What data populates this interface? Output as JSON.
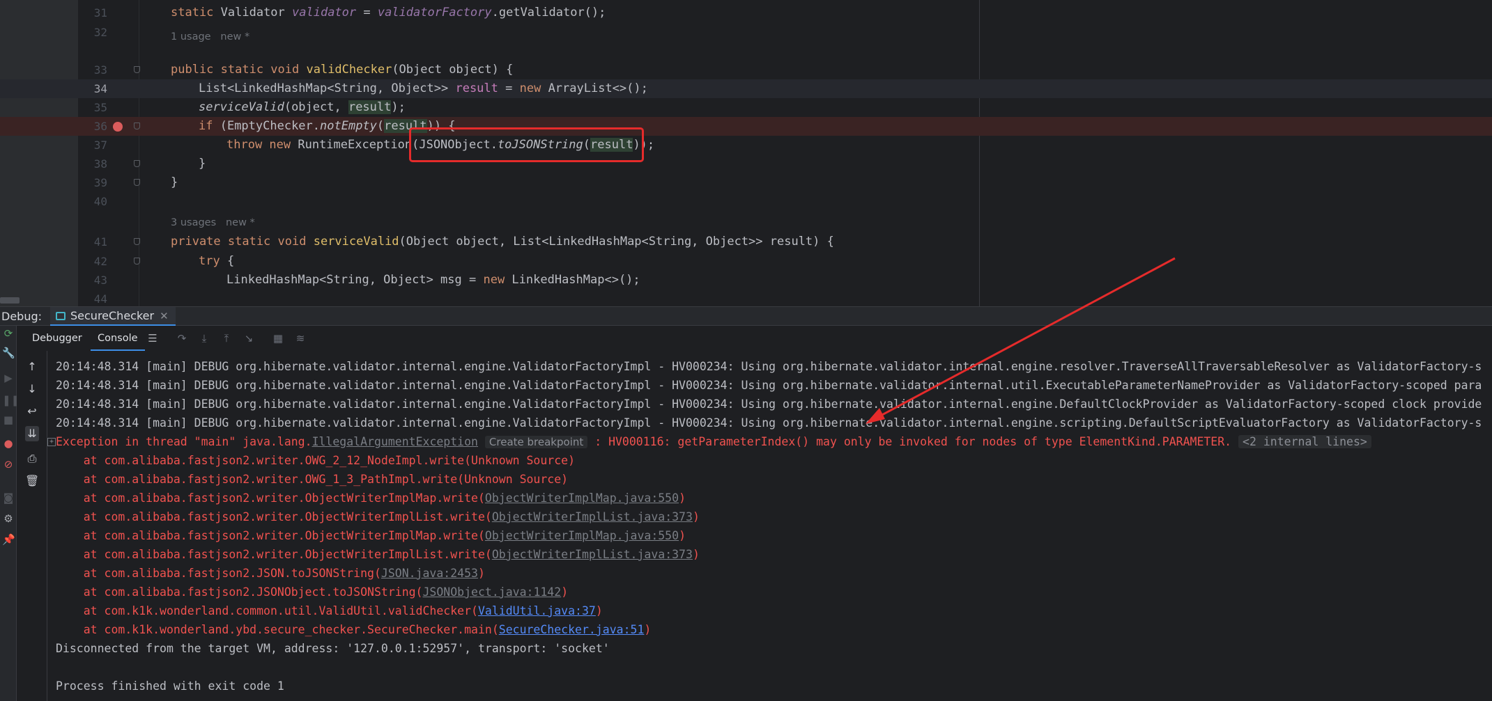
{
  "editor": {
    "lines": [
      {
        "num": "31",
        "code": "static Validator validator = validatorFactory.getValidator();"
      },
      {
        "num": "32",
        "code": ""
      },
      {
        "num": "33",
        "code": "public static void validChecker(Object object) {"
      },
      {
        "num": "34",
        "code": "List<LinkedHashMap<String, Object>> result = new ArrayList<>();"
      },
      {
        "num": "35",
        "code": "serviceValid(object, result);"
      },
      {
        "num": "36",
        "code": "if (EmptyChecker.notEmpty(result)) {"
      },
      {
        "num": "37",
        "code": "throw new RuntimeException(JSONObject.toJSONString(result));"
      },
      {
        "num": "38",
        "code": "}"
      },
      {
        "num": "39",
        "code": "}"
      },
      {
        "num": "40",
        "code": ""
      },
      {
        "num": "41",
        "code": "private static void serviceValid(Object object, List<LinkedHashMap<String, Object>> result) {"
      },
      {
        "num": "42",
        "code": "try {"
      },
      {
        "num": "43",
        "code": "LinkedHashMap<String, Object> msg = new LinkedHashMap<>();"
      },
      {
        "num": "44",
        "code": ""
      }
    ],
    "hint_valid_checker": "1 usage   new *",
    "hint_service_valid": "3 usages   new *"
  },
  "debug": {
    "title": "Debug:",
    "session_tab": "SecureChecker",
    "close_glyph": "✕",
    "subtabs": {
      "debugger": "Debugger",
      "console": "Console"
    }
  },
  "console": {
    "log_lines": [
      "20:14:48.314 [main] DEBUG org.hibernate.validator.internal.engine.ValidatorFactoryImpl - HV000234: Using org.hibernate.validator.internal.engine.resolver.TraverseAllTraversableResolver as ValidatorFactory-s",
      "20:14:48.314 [main] DEBUG org.hibernate.validator.internal.engine.ValidatorFactoryImpl - HV000234: Using org.hibernate.validator.internal.util.ExecutableParameterNameProvider as ValidatorFactory-scoped para",
      "20:14:48.314 [main] DEBUG org.hibernate.validator.internal.engine.ValidatorFactoryImpl - HV000234: Using org.hibernate.validator.internal.engine.DefaultClockProvider as ValidatorFactory-scoped clock provide",
      "20:14:48.314 [main] DEBUG org.hibernate.validator.internal.engine.ValidatorFactoryImpl - HV000234: Using org.hibernate.validator.internal.engine.scripting.DefaultScriptEvaluatorFactory as ValidatorFactory-s"
    ],
    "exception": {
      "prefix": "Exception in thread \"main\" java.lang.",
      "class_link": "IllegalArgumentException",
      "create_breakpoint": "Create breakpoint",
      "message": " : HV000116: getParameterIndex() may only be invoked for nodes of type ElementKind.PARAMETER. ",
      "internal_lines": "<2 internal lines>"
    },
    "stack": [
      {
        "text": "    at com.alibaba.fastjson2.writer.OWG_2_12_NodeImpl.write(Unknown Source)",
        "link": "",
        "tail": ""
      },
      {
        "text": "    at com.alibaba.fastjson2.writer.OWG_1_3_PathImpl.write(Unknown Source)",
        "link": "",
        "tail": ""
      },
      {
        "text": "    at com.alibaba.fastjson2.writer.ObjectWriterImplMap.write(",
        "link": "ObjectWriterImplMap.java:550",
        "tail": ")"
      },
      {
        "text": "    at com.alibaba.fastjson2.writer.ObjectWriterImplList.write(",
        "link": "ObjectWriterImplList.java:373",
        "tail": ")"
      },
      {
        "text": "    at com.alibaba.fastjson2.writer.ObjectWriterImplMap.write(",
        "link": "ObjectWriterImplMap.java:550",
        "tail": ")"
      },
      {
        "text": "    at com.alibaba.fastjson2.writer.ObjectWriterImplList.write(",
        "link": "ObjectWriterImplList.java:373",
        "tail": ")"
      },
      {
        "text": "    at com.alibaba.fastjson2.JSON.toJSONString(",
        "link": "JSON.java:2453",
        "tail": ")"
      },
      {
        "text": "    at com.alibaba.fastjson2.JSONObject.toJSONString(",
        "link": "JSONObject.java:1142",
        "tail": ")"
      },
      {
        "text": "    at com.k1k.wonderland.common.util.ValidUtil.validChecker(",
        "link": "ValidUtil.java:37",
        "tail": ")"
      },
      {
        "text": "    at com.k1k.wonderland.ybd.secure_checker.SecureChecker.main(",
        "link": "SecureChecker.java:51",
        "tail": ")"
      }
    ],
    "disconnected": "Disconnected from the target VM, address: '127.0.0.1:52957', transport: 'socket'",
    "finished": "Process finished with exit code 1"
  },
  "colors": {
    "error": "#f0524f",
    "accent": "#3d8ee6",
    "annotation": "#e52b2b"
  }
}
